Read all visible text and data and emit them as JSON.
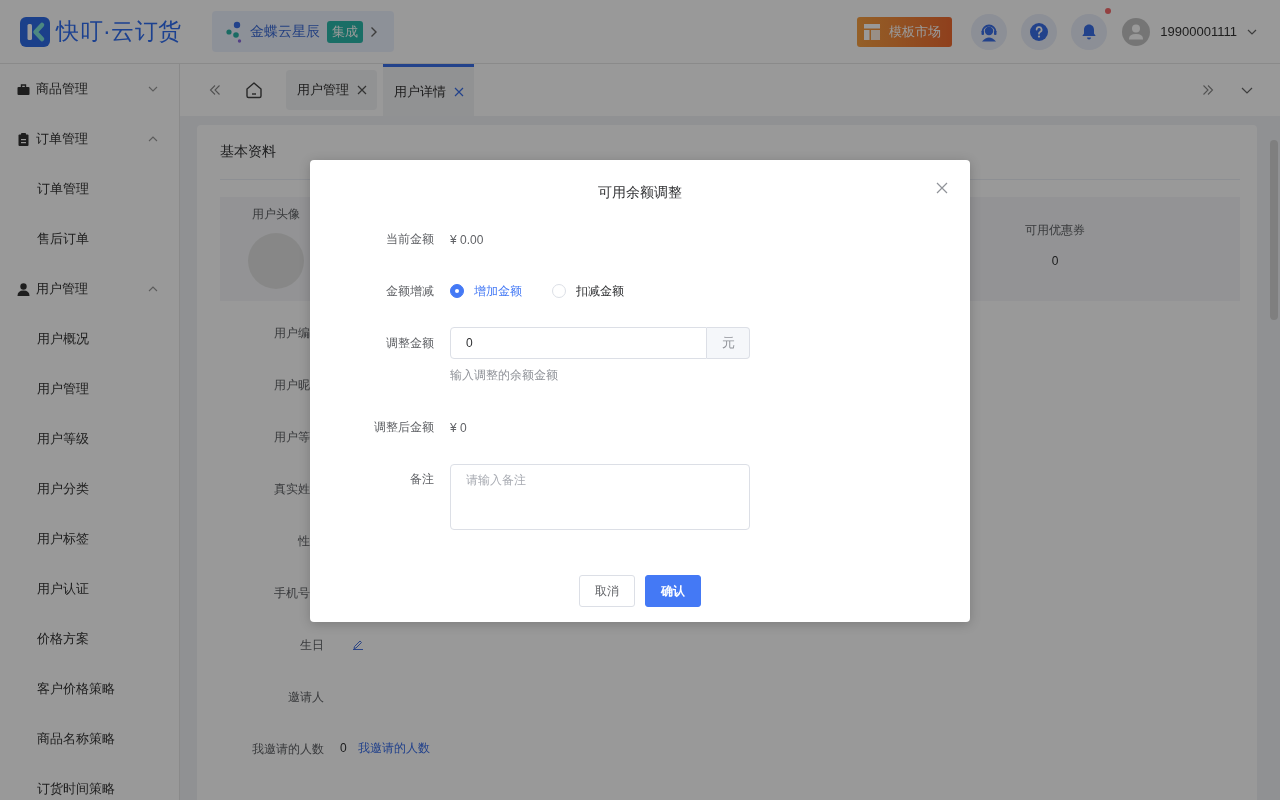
{
  "header": {
    "logo_text": "快叮·云订货",
    "integration": {
      "name": "金蝶云星辰",
      "badge": "集成"
    },
    "template_button": "模板市场",
    "unread_notifications": true,
    "username": "19900001111"
  },
  "sidebar": {
    "groups": [
      {
        "label": "商品管理",
        "expanded": false
      },
      {
        "label": "订单管理",
        "expanded": true,
        "children": [
          {
            "label": "订单管理"
          },
          {
            "label": "售后订单"
          }
        ]
      },
      {
        "label": "用户管理",
        "expanded": true,
        "children": [
          {
            "label": "用户概况"
          },
          {
            "label": "用户管理"
          },
          {
            "label": "用户等级"
          },
          {
            "label": "用户分类"
          },
          {
            "label": "用户标签"
          },
          {
            "label": "用户认证"
          },
          {
            "label": "价格方案"
          },
          {
            "label": "客户价格策略"
          },
          {
            "label": "商品名称策略"
          },
          {
            "label": "订货时间策略"
          }
        ]
      }
    ]
  },
  "tabs": [
    {
      "label": "用户管理",
      "selected": false
    },
    {
      "label": "用户详情",
      "selected": true
    }
  ],
  "content": {
    "section_title": "基本资料",
    "avatar_label": "用户头像",
    "stats": [
      {
        "label": "可用优惠券",
        "value": "0"
      }
    ],
    "fields": [
      {
        "label": "用户编",
        "covered": true,
        "editable": false
      },
      {
        "label": "用户昵",
        "covered": true,
        "editable": false
      },
      {
        "label": "用户等",
        "covered": true,
        "editable": false
      },
      {
        "label": "真实姓",
        "covered": true,
        "editable": false
      },
      {
        "label": "性",
        "covered": true,
        "editable": false
      },
      {
        "label": "手机号",
        "covered": true,
        "editable": false
      },
      {
        "label": "生日",
        "covered": false,
        "editable": true
      },
      {
        "label": "邀请人",
        "covered": false,
        "editable": false
      },
      {
        "label": "我邀请的人数",
        "covered": false,
        "editable": false,
        "value": "0",
        "link": "我邀请的人数"
      }
    ]
  },
  "dialog": {
    "title": "可用余额调整",
    "rows": [
      {
        "kind": "text",
        "label": "当前金额",
        "value": "¥ 0.00"
      },
      {
        "kind": "radio",
        "label": "金额增减",
        "options": [
          {
            "label": "增加金额",
            "selected": true
          },
          {
            "label": "扣减金额",
            "selected": false
          }
        ]
      },
      {
        "kind": "input",
        "label": "调整金额",
        "value": "0",
        "suffix": "元",
        "hint": "输入调整的余额金额"
      },
      {
        "kind": "text",
        "label": "调整后金额",
        "value": "¥ 0"
      },
      {
        "kind": "textarea",
        "label": "备注",
        "placeholder": "请输入备注"
      }
    ],
    "buttons": [
      {
        "label": "取消",
        "kind": "default"
      },
      {
        "label": "确认",
        "kind": "primary"
      }
    ]
  }
}
